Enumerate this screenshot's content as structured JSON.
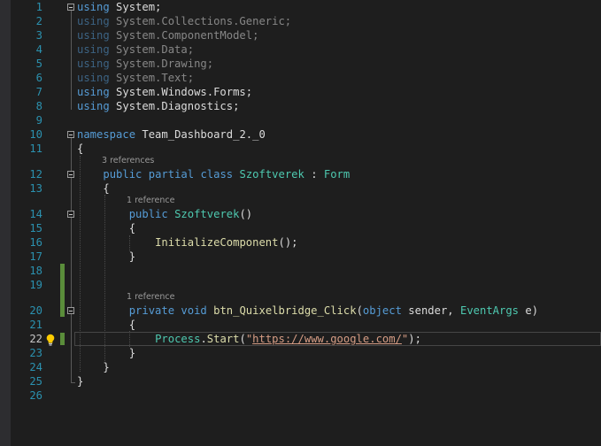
{
  "editor": {
    "current_line": "22",
    "lines": [
      {
        "n": "1",
        "tokens": [
          {
            "t": "using",
            "c": "kw"
          },
          {
            "t": " System;"
          }
        ]
      },
      {
        "n": "2",
        "tokens": [
          {
            "t": "using",
            "c": "kw dim"
          },
          {
            "t": " System.Collections.Generic;",
            "c": "dim"
          }
        ]
      },
      {
        "n": "3",
        "tokens": [
          {
            "t": "using",
            "c": "kw dim"
          },
          {
            "t": " System.ComponentModel;",
            "c": "dim"
          }
        ]
      },
      {
        "n": "4",
        "tokens": [
          {
            "t": "using",
            "c": "kw dim"
          },
          {
            "t": " System.Data;",
            "c": "dim"
          }
        ]
      },
      {
        "n": "5",
        "tokens": [
          {
            "t": "using",
            "c": "kw dim"
          },
          {
            "t": " System.Drawing;",
            "c": "dim"
          }
        ]
      },
      {
        "n": "6",
        "tokens": [
          {
            "t": "using",
            "c": "kw dim"
          },
          {
            "t": " System.Text;",
            "c": "dim"
          }
        ]
      },
      {
        "n": "7",
        "tokens": [
          {
            "t": "using",
            "c": "kw"
          },
          {
            "t": " System.Windows.Forms;"
          }
        ]
      },
      {
        "n": "8",
        "tokens": [
          {
            "t": "using",
            "c": "kw"
          },
          {
            "t": " System.Diagnostics;"
          }
        ]
      },
      {
        "n": "9",
        "tokens": []
      },
      {
        "n": "10",
        "tokens": [
          {
            "t": "namespace",
            "c": "kw"
          },
          {
            "t": " Team_Dashboard_2._0"
          }
        ]
      },
      {
        "n": "11",
        "tokens": [
          {
            "t": "{"
          }
        ]
      },
      {
        "n": "12",
        "lens": "3 references",
        "tokens": [
          {
            "t": "    "
          },
          {
            "t": "public",
            "c": "kw"
          },
          {
            "t": " "
          },
          {
            "t": "partial",
            "c": "kw"
          },
          {
            "t": " "
          },
          {
            "t": "class",
            "c": "kw"
          },
          {
            "t": " "
          },
          {
            "t": "Szoftverek",
            "c": "ty"
          },
          {
            "t": " : "
          },
          {
            "t": "Form",
            "c": "ty"
          }
        ]
      },
      {
        "n": "13",
        "tokens": [
          {
            "t": "    {"
          }
        ]
      },
      {
        "n": "14",
        "lens": "1 reference",
        "tokens": [
          {
            "t": "        "
          },
          {
            "t": "public",
            "c": "kw"
          },
          {
            "t": " "
          },
          {
            "t": "Szoftverek",
            "c": "ty"
          },
          {
            "t": "()"
          }
        ]
      },
      {
        "n": "15",
        "tokens": [
          {
            "t": "        {"
          }
        ]
      },
      {
        "n": "16",
        "tokens": [
          {
            "t": "            "
          },
          {
            "t": "InitializeComponent",
            "c": "fn"
          },
          {
            "t": "();"
          }
        ]
      },
      {
        "n": "17",
        "tokens": [
          {
            "t": "        }"
          }
        ]
      },
      {
        "n": "18",
        "tokens": []
      },
      {
        "n": "19",
        "tokens": []
      },
      {
        "n": "20",
        "lens": "1 reference",
        "tokens": [
          {
            "t": "        "
          },
          {
            "t": "private",
            "c": "kw"
          },
          {
            "t": " "
          },
          {
            "t": "void",
            "c": "kw"
          },
          {
            "t": " "
          },
          {
            "t": "btn_Quixelbridge_Click",
            "c": "fn"
          },
          {
            "t": "("
          },
          {
            "t": "object",
            "c": "kw"
          },
          {
            "t": " sender, "
          },
          {
            "t": "EventArgs",
            "c": "ty"
          },
          {
            "t": " e)"
          }
        ]
      },
      {
        "n": "21",
        "tokens": [
          {
            "t": "        {"
          }
        ]
      },
      {
        "n": "22",
        "tokens": [
          {
            "t": "            "
          },
          {
            "t": "Process",
            "c": "ty"
          },
          {
            "t": "."
          },
          {
            "t": "Start",
            "c": "fn"
          },
          {
            "t": "("
          },
          {
            "t": "\"",
            "c": "st"
          },
          {
            "t": "https://www.google.com/",
            "c": "url"
          },
          {
            "t": "\"",
            "c": "st"
          },
          {
            "t": ");"
          }
        ]
      },
      {
        "n": "23",
        "tokens": [
          {
            "t": "        }"
          }
        ]
      },
      {
        "n": "24",
        "tokens": [
          {
            "t": "    }"
          }
        ]
      },
      {
        "n": "25",
        "tokens": [
          {
            "t": "}"
          }
        ]
      },
      {
        "n": "26",
        "tokens": []
      }
    ]
  },
  "icons": {
    "lightbulb": "lightbulb-icon",
    "fold_toggle": "collapse-toggle-icon"
  },
  "colors": {
    "background": "#1e1e1e",
    "line_number": "#2b91af",
    "keyword": "#569cd6",
    "type": "#4ec9b0",
    "method": "#dcdcaa",
    "string": "#d69d85",
    "plain_text": "#dcdcdc",
    "change_marker": "#5a8d3a"
  }
}
